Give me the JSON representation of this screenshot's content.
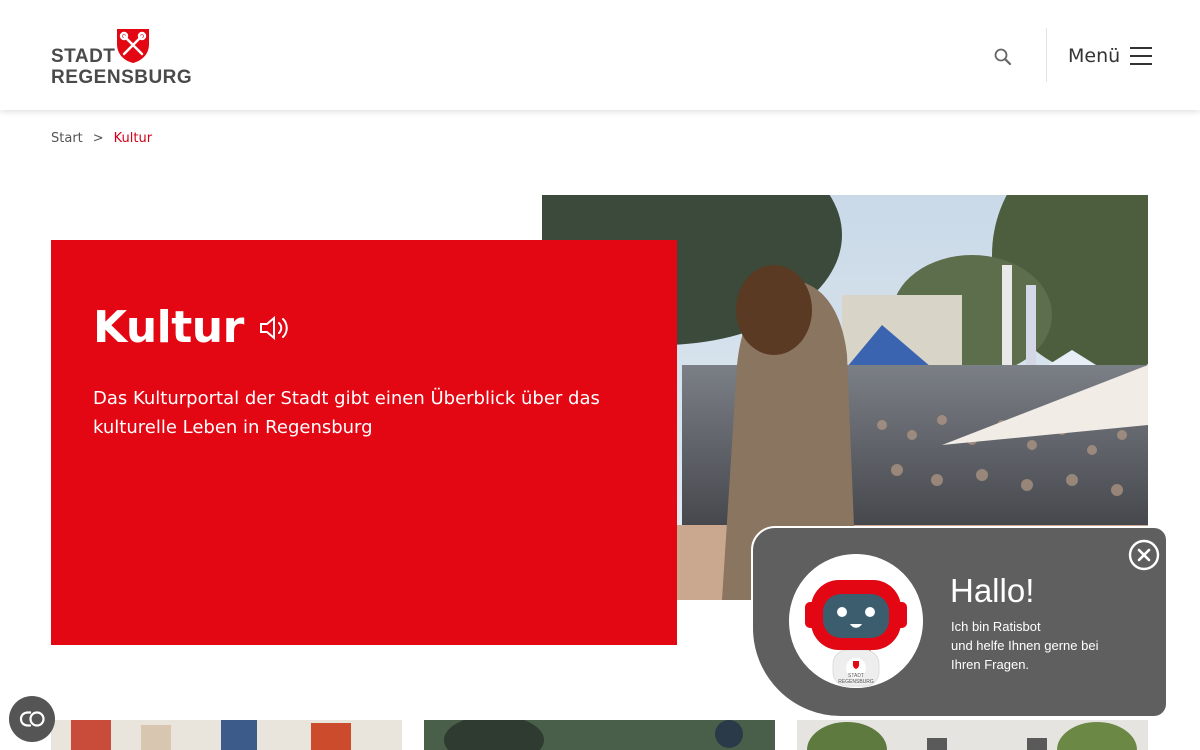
{
  "header": {
    "logo": {
      "line1": "STADT",
      "line2": "REGENSBURG"
    },
    "search_icon": "search-icon",
    "menu_label": "Menü",
    "menu_icon": "hamburger-icon"
  },
  "breadcrumb": {
    "start": "Start",
    "separator": ">",
    "current": "Kultur"
  },
  "hero": {
    "title": "Kultur",
    "read_aloud_icon": "speaker-icon",
    "description": "Das Kulturportal der Stadt gibt einen Überblick über das kulturelle Leben in Regensburg",
    "image": "concert-crowd-photo"
  },
  "chatbot": {
    "greeting": "Hallo!",
    "line1": "Ich bin Ratisbot",
    "line2": "und helfe Ihnen gerne bei",
    "line3": "Ihren Fragen.",
    "avatar_label_line1": "STADT",
    "avatar_label_line2": "REGENSBURG",
    "close_icon": "close-icon"
  },
  "accessibility": {
    "icon": "accessibility-toggle-icon"
  },
  "colors": {
    "brand_red": "#e30613",
    "breadcrumb_active": "#d4001a",
    "chat_bg": "#5f5f5f",
    "text_dark": "#333333"
  }
}
